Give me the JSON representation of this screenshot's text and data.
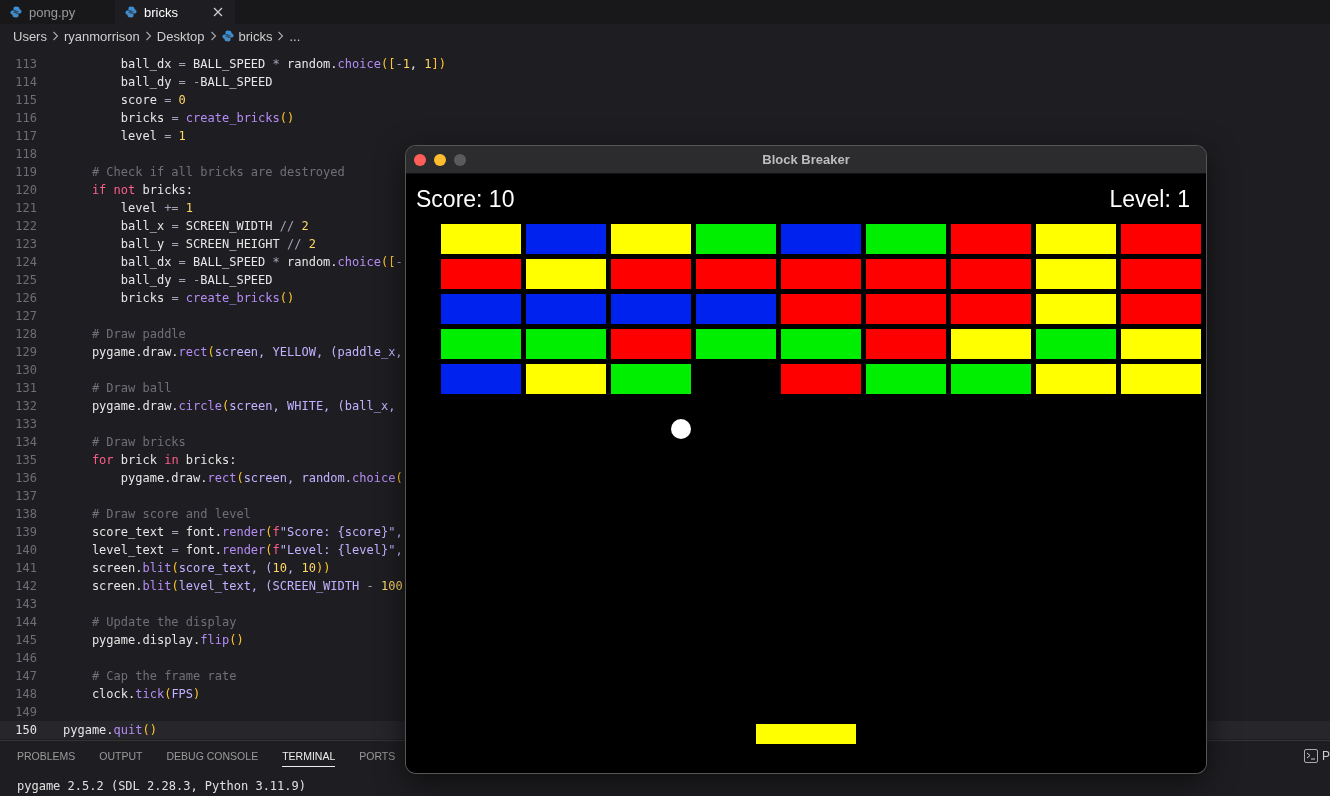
{
  "editor_tabs": [
    {
      "label": "pong.py",
      "selected": false,
      "closable": false
    },
    {
      "label": "bricks",
      "selected": true,
      "closable": true
    }
  ],
  "breadcrumb": [
    {
      "label": "Users",
      "file": false
    },
    {
      "label": "ryanmorrison",
      "file": false
    },
    {
      "label": "Desktop",
      "file": false
    },
    {
      "label": "bricks",
      "file": true
    },
    {
      "label": "...",
      "file": false
    }
  ],
  "code_lines": [
    {
      "number": "113",
      "current": false,
      "tokens": [
        {
          "text": "        ball_dx",
          "kind": "plain"
        },
        {
          "text": " = ",
          "kind": "op"
        },
        {
          "text": "BALL_SPEED",
          "kind": "plain"
        },
        {
          "text": " * ",
          "kind": "op"
        },
        {
          "text": "random.",
          "kind": "plain"
        },
        {
          "text": "choice",
          "kind": "func"
        },
        {
          "text": "([",
          "kind": "bracket"
        },
        {
          "text": "-",
          "kind": "op"
        },
        {
          "text": "1",
          "kind": "num"
        },
        {
          "text": ", ",
          "kind": "plain"
        },
        {
          "text": "1",
          "kind": "num"
        },
        {
          "text": "])",
          "kind": "bracket"
        }
      ]
    },
    {
      "number": "114",
      "current": false,
      "tokens": [
        {
          "text": "        ball_dy",
          "kind": "plain"
        },
        {
          "text": " = ",
          "kind": "op"
        },
        {
          "text": "-",
          "kind": "op"
        },
        {
          "text": "BALL_SPEED",
          "kind": "plain"
        }
      ]
    },
    {
      "number": "115",
      "current": false,
      "tokens": [
        {
          "text": "        score",
          "kind": "plain"
        },
        {
          "text": " = ",
          "kind": "op"
        },
        {
          "text": "0",
          "kind": "num"
        }
      ]
    },
    {
      "number": "116",
      "current": false,
      "tokens": [
        {
          "text": "        bricks",
          "kind": "plain"
        },
        {
          "text": " = ",
          "kind": "op"
        },
        {
          "text": "create_bricks",
          "kind": "func"
        },
        {
          "text": "()",
          "kind": "bracket"
        }
      ]
    },
    {
      "number": "117",
      "current": false,
      "tokens": [
        {
          "text": "        level",
          "kind": "plain"
        },
        {
          "text": " = ",
          "kind": "op"
        },
        {
          "text": "1",
          "kind": "num"
        }
      ]
    },
    {
      "number": "118",
      "current": false
    },
    {
      "number": "119",
      "current": false,
      "tokens": [
        {
          "text": "    # Check if all bricks are destroyed",
          "kind": "comment"
        }
      ]
    },
    {
      "number": "120",
      "current": false,
      "tokens": [
        {
          "text": "    if",
          "kind": "keyword"
        },
        {
          "text": " not",
          "kind": "keyword"
        },
        {
          "text": " bricks:",
          "kind": "plain"
        }
      ]
    },
    {
      "number": "121",
      "current": false,
      "tokens": [
        {
          "text": "        level",
          "kind": "plain"
        },
        {
          "text": " += ",
          "kind": "op"
        },
        {
          "text": "1",
          "kind": "num"
        }
      ]
    },
    {
      "number": "122",
      "current": false,
      "tokens": [
        {
          "text": "        ball_x",
          "kind": "plain"
        },
        {
          "text": " = ",
          "kind": "op"
        },
        {
          "text": "SCREEN_WIDTH",
          "kind": "plain"
        },
        {
          "text": " // ",
          "kind": "op"
        },
        {
          "text": "2",
          "kind": "num"
        }
      ]
    },
    {
      "number": "123",
      "current": false,
      "tokens": [
        {
          "text": "        ball_y",
          "kind": "plain"
        },
        {
          "text": " = ",
          "kind": "op"
        },
        {
          "text": "SCREEN_HEIGHT",
          "kind": "plain"
        },
        {
          "text": " // ",
          "kind": "op"
        },
        {
          "text": "2",
          "kind": "num"
        }
      ]
    },
    {
      "number": "124",
      "current": false,
      "tokens": [
        {
          "text": "        ball_dx",
          "kind": "plain"
        },
        {
          "text": " = ",
          "kind": "op"
        },
        {
          "text": "BALL_SPEED",
          "kind": "plain"
        },
        {
          "text": " * ",
          "kind": "op"
        },
        {
          "text": "random.",
          "kind": "plain"
        },
        {
          "text": "choice",
          "kind": "func"
        },
        {
          "text": "([",
          "kind": "bracket"
        },
        {
          "text": "-",
          "kind": "op"
        }
      ]
    },
    {
      "number": "125",
      "current": false,
      "tokens": [
        {
          "text": "        ball_dy",
          "kind": "plain"
        },
        {
          "text": " = ",
          "kind": "op"
        },
        {
          "text": "-",
          "kind": "op"
        },
        {
          "text": "BALL_SPEED",
          "kind": "plain"
        }
      ]
    },
    {
      "number": "126",
      "current": false,
      "tokens": [
        {
          "text": "        bricks",
          "kind": "plain"
        },
        {
          "text": " = ",
          "kind": "op"
        },
        {
          "text": "create_bricks",
          "kind": "func"
        },
        {
          "text": "()",
          "kind": "bracket"
        }
      ]
    },
    {
      "number": "127",
      "current": false
    },
    {
      "number": "128",
      "current": false,
      "tokens": [
        {
          "text": "    # Draw paddle",
          "kind": "comment"
        }
      ]
    },
    {
      "number": "129",
      "current": false,
      "tokens": [
        {
          "text": "    pygame.draw.",
          "kind": "plain"
        },
        {
          "text": "rect",
          "kind": "func"
        },
        {
          "text": "(",
          "kind": "bracket"
        },
        {
          "text": "screen, YELLOW, (paddle_x,",
          "kind": "arg"
        }
      ]
    },
    {
      "number": "130",
      "current": false
    },
    {
      "number": "131",
      "current": false,
      "tokens": [
        {
          "text": "    # Draw ball",
          "kind": "comment"
        }
      ]
    },
    {
      "number": "132",
      "current": false,
      "tokens": [
        {
          "text": "    pygame.draw.",
          "kind": "plain"
        },
        {
          "text": "circle",
          "kind": "func"
        },
        {
          "text": "(",
          "kind": "bracket"
        },
        {
          "text": "screen, WHITE, (ball_x,",
          "kind": "arg"
        }
      ]
    },
    {
      "number": "133",
      "current": false
    },
    {
      "number": "134",
      "current": false,
      "tokens": [
        {
          "text": "    # Draw bricks",
          "kind": "comment"
        }
      ]
    },
    {
      "number": "135",
      "current": false,
      "tokens": [
        {
          "text": "    for",
          "kind": "keyword"
        },
        {
          "text": " brick ",
          "kind": "plain"
        },
        {
          "text": "in",
          "kind": "keyword"
        },
        {
          "text": " bricks:",
          "kind": "plain"
        }
      ]
    },
    {
      "number": "136",
      "current": false,
      "tokens": [
        {
          "text": "        pygame.draw.",
          "kind": "plain"
        },
        {
          "text": "rect",
          "kind": "func"
        },
        {
          "text": "(",
          "kind": "bracket"
        },
        {
          "text": "screen, random.",
          "kind": "arg"
        },
        {
          "text": "choice",
          "kind": "func"
        },
        {
          "text": "(",
          "kind": "bracket"
        }
      ]
    },
    {
      "number": "137",
      "current": false
    },
    {
      "number": "138",
      "current": false,
      "tokens": [
        {
          "text": "    # Draw score and level",
          "kind": "comment"
        }
      ]
    },
    {
      "number": "139",
      "current": false,
      "tokens": [
        {
          "text": "    score_text",
          "kind": "plain"
        },
        {
          "text": " = ",
          "kind": "op"
        },
        {
          "text": "font.",
          "kind": "plain"
        },
        {
          "text": "render",
          "kind": "func"
        },
        {
          "text": "(",
          "kind": "bracket"
        },
        {
          "text": "f",
          "kind": "keyword"
        },
        {
          "text": "\"Score: {score}\",",
          "kind": "arg"
        }
      ]
    },
    {
      "number": "140",
      "current": false,
      "tokens": [
        {
          "text": "    level_text",
          "kind": "plain"
        },
        {
          "text": " = ",
          "kind": "op"
        },
        {
          "text": "font.",
          "kind": "plain"
        },
        {
          "text": "render",
          "kind": "func"
        },
        {
          "text": "(",
          "kind": "bracket"
        },
        {
          "text": "f",
          "kind": "keyword"
        },
        {
          "text": "\"Level: {level}\",",
          "kind": "arg"
        }
      ]
    },
    {
      "number": "141",
      "current": false,
      "tokens": [
        {
          "text": "    screen.",
          "kind": "plain"
        },
        {
          "text": "blit",
          "kind": "func"
        },
        {
          "text": "(",
          "kind": "bracket"
        },
        {
          "text": "score_text, (",
          "kind": "arg"
        },
        {
          "text": "10",
          "kind": "num"
        },
        {
          "text": ", ",
          "kind": "arg"
        },
        {
          "text": "10",
          "kind": "num"
        },
        {
          "text": "))",
          "kind": "bracket"
        }
      ]
    },
    {
      "number": "142",
      "current": false,
      "tokens": [
        {
          "text": "    screen.",
          "kind": "plain"
        },
        {
          "text": "blit",
          "kind": "func"
        },
        {
          "text": "(",
          "kind": "bracket"
        },
        {
          "text": "level_text, (SCREEN_WIDTH ",
          "kind": "arg"
        },
        {
          "text": "-",
          "kind": "op"
        },
        {
          "text": " 100",
          "kind": "num"
        }
      ]
    },
    {
      "number": "143",
      "current": false
    },
    {
      "number": "144",
      "current": false,
      "tokens": [
        {
          "text": "    # Update the display",
          "kind": "comment"
        }
      ]
    },
    {
      "number": "145",
      "current": false,
      "tokens": [
        {
          "text": "    pygame.display.",
          "kind": "plain"
        },
        {
          "text": "flip",
          "kind": "func"
        },
        {
          "text": "()",
          "kind": "bracket"
        }
      ]
    },
    {
      "number": "146",
      "current": false
    },
    {
      "number": "147",
      "current": false,
      "tokens": [
        {
          "text": "    # Cap the frame rate",
          "kind": "comment"
        }
      ]
    },
    {
      "number": "148",
      "current": false,
      "tokens": [
        {
          "text": "    clock.",
          "kind": "plain"
        },
        {
          "text": "tick",
          "kind": "func"
        },
        {
          "text": "(",
          "kind": "bracket"
        },
        {
          "text": "FPS",
          "kind": "arg"
        },
        {
          "text": ")",
          "kind": "bracket"
        }
      ]
    },
    {
      "number": "149",
      "current": false
    },
    {
      "number": "150",
      "current": true,
      "tokens": [
        {
          "text": "pygame.",
          "kind": "plain"
        },
        {
          "text": "quit",
          "kind": "func"
        },
        {
          "text": "()",
          "kind": "bracket"
        }
      ]
    }
  ],
  "panel_tabs": [
    {
      "label": "PROBLEMS",
      "selected": false
    },
    {
      "label": "OUTPUT",
      "selected": false
    },
    {
      "label": "DEBUG CONSOLE",
      "selected": false
    },
    {
      "label": "TERMINAL",
      "selected": true
    },
    {
      "label": "PORTS",
      "selected": false
    }
  ],
  "terminal_lines": [
    "pygame 2.5.2 (SDL 2.28.3, Python 3.11.9)"
  ],
  "terminal_side_label": "P",
  "game_window": {
    "title": "Block Breaker",
    "score": "Score: 10",
    "level": "Level: 1",
    "bricks": [
      [
        {
          "kind": "brick",
          "color": "#ffff00"
        },
        {
          "kind": "brick",
          "color": "#0022ee"
        },
        {
          "kind": "brick",
          "color": "#ffff00"
        },
        {
          "kind": "brick",
          "color": "#00ee00"
        },
        {
          "kind": "brick",
          "color": "#0022ee"
        },
        {
          "kind": "brick",
          "color": "#00ee00"
        },
        {
          "kind": "brick",
          "color": "#ff0000"
        },
        {
          "kind": "brick",
          "color": "#ffff00"
        },
        {
          "kind": "brick",
          "color": "#ff0000"
        }
      ],
      [
        {
          "kind": "brick",
          "color": "#ff0000"
        },
        {
          "kind": "brick",
          "color": "#ffff00"
        },
        {
          "kind": "brick",
          "color": "#ff0000"
        },
        {
          "kind": "brick",
          "color": "#ff0000"
        },
        {
          "kind": "brick",
          "color": "#ff0000"
        },
        {
          "kind": "brick",
          "color": "#ff0000"
        },
        {
          "kind": "brick",
          "color": "#ff0000"
        },
        {
          "kind": "brick",
          "color": "#ffff00"
        },
        {
          "kind": "brick",
          "color": "#ff0000"
        }
      ],
      [
        {
          "kind": "brick",
          "color": "#0022ee"
        },
        {
          "kind": "brick",
          "color": "#0022ee"
        },
        {
          "kind": "brick",
          "color": "#0022ee"
        },
        {
          "kind": "brick",
          "color": "#0022ee"
        },
        {
          "kind": "brick",
          "color": "#ff0000"
        },
        {
          "kind": "brick",
          "color": "#ff0000"
        },
        {
          "kind": "brick",
          "color": "#ff0000"
        },
        {
          "kind": "brick",
          "color": "#ffff00"
        },
        {
          "kind": "brick",
          "color": "#ff0000"
        }
      ],
      [
        {
          "kind": "brick",
          "color": "#00ee00"
        },
        {
          "kind": "brick",
          "color": "#00ee00"
        },
        {
          "kind": "brick",
          "color": "#ff0000"
        },
        {
          "kind": "brick",
          "color": "#00ee00"
        },
        {
          "kind": "brick",
          "color": "#00ee00"
        },
        {
          "kind": "brick",
          "color": "#ff0000"
        },
        {
          "kind": "brick",
          "color": "#ffff00"
        },
        {
          "kind": "brick",
          "color": "#00ee00"
        },
        {
          "kind": "brick",
          "color": "#ffff00"
        }
      ],
      [
        {
          "kind": "brick",
          "color": "#0022ee"
        },
        {
          "kind": "brick",
          "color": "#ffff00"
        },
        {
          "kind": "brick",
          "color": "#00ee00"
        },
        {
          "kind": "gap"
        },
        {
          "kind": "brick",
          "color": "#ff0000"
        },
        {
          "kind": "brick",
          "color": "#00ee00"
        },
        {
          "kind": "brick",
          "color": "#00ee00"
        },
        {
          "kind": "brick",
          "color": "#ffff00"
        },
        {
          "kind": "brick",
          "color": "#ffff00"
        }
      ]
    ]
  }
}
